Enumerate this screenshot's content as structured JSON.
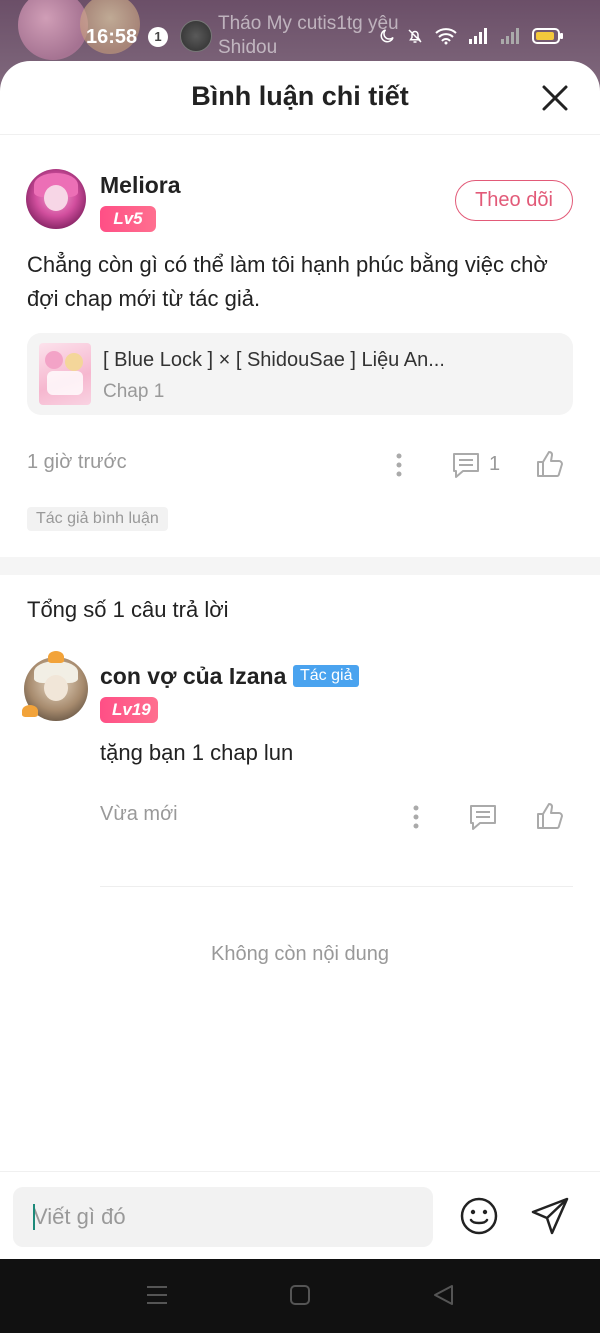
{
  "status_bar": {
    "time": "16:58",
    "notif_count": "1",
    "notif_text": "Tháo My cutis1tg yêu Shidou"
  },
  "header": {
    "title": "Bình luận chi tiết"
  },
  "comment": {
    "username": "Meliora",
    "level": "Lv5",
    "follow_label": "Theo dõi",
    "text": "Chẳng còn gì có thể làm tôi hạnh phúc bằng việc chờ đợi chap mới từ tác giả.",
    "story_title": "[ Blue Lock ] × [ ShidouSae ] Liệu An...",
    "story_chapter": "Chap 1",
    "time_ago": "1 giờ trước",
    "reply_count": "1",
    "tag": "Tác giả bình luận"
  },
  "replies": {
    "title": "Tổng số 1 câu trả lời",
    "items": [
      {
        "username": "con vợ của Izana",
        "author_badge": "Tác giả",
        "level": "Lv19",
        "text": "tặng bạn 1 chap lun",
        "time_ago": "Vừa mới"
      }
    ],
    "end_text": "Không còn nội dung"
  },
  "input": {
    "placeholder": "Viết gì đó"
  },
  "colors": {
    "accent_pink": "#e25a78",
    "level_badge": "#ff5a86",
    "author_badge": "#4aa3ef"
  }
}
